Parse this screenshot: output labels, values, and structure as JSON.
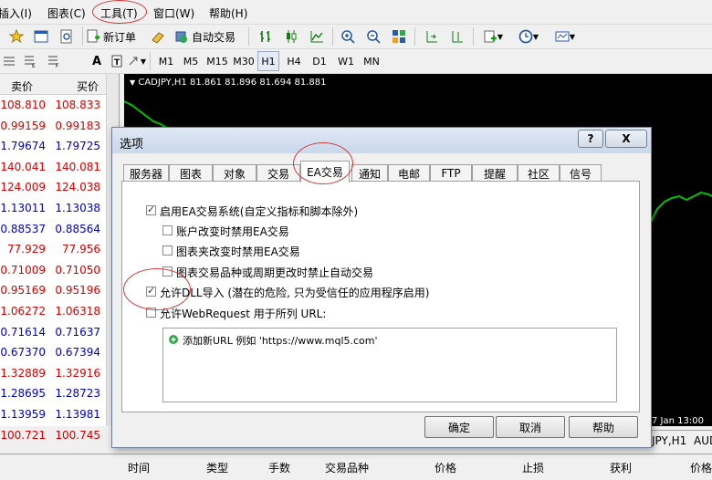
{
  "menu": {
    "items": [
      "插入(I)",
      "图表(C)",
      "工具(T)",
      "窗口(W)",
      "帮助(H)"
    ]
  },
  "toolbar1": {
    "new_order": "新订单",
    "auto_trading": "自动交易"
  },
  "toolbar2": {
    "timeframes": [
      "M1",
      "M5",
      "M15",
      "M30",
      "H1",
      "H4",
      "D1",
      "W1",
      "MN"
    ]
  },
  "market_watch": {
    "col_bid": "卖价",
    "col_ask": "买价",
    "rows": [
      {
        "bid": "108.810",
        "ask": "108.833",
        "color": "red"
      },
      {
        "bid": "0.99159",
        "ask": "0.99183",
        "color": "red"
      },
      {
        "bid": "1.79674",
        "ask": "1.79725",
        "color": "blue"
      },
      {
        "bid": "140.041",
        "ask": "140.081",
        "color": "red"
      },
      {
        "bid": "124.009",
        "ask": "124.038",
        "color": "red"
      },
      {
        "bid": "1.13011",
        "ask": "1.13038",
        "color": "blue"
      },
      {
        "bid": "0.88537",
        "ask": "0.88564",
        "color": "blue"
      },
      {
        "bid": "77.929",
        "ask": "77.956",
        "color": "red"
      },
      {
        "bid": "0.71009",
        "ask": "0.71050",
        "color": "red"
      },
      {
        "bid": "0.95169",
        "ask": "0.95196",
        "color": "red"
      },
      {
        "bid": "1.06272",
        "ask": "1.06318",
        "color": "red"
      },
      {
        "bid": "0.71614",
        "ask": "0.71637",
        "color": "blue"
      },
      {
        "bid": "0.67370",
        "ask": "0.67394",
        "color": "blue"
      },
      {
        "bid": "1.32889",
        "ask": "1.32916",
        "color": "red"
      },
      {
        "bid": "1.28695",
        "ask": "1.28723",
        "color": "blue"
      },
      {
        "bid": "1.13959",
        "ask": "1.13981",
        "color": "blue"
      },
      {
        "bid": "100.721",
        "ask": "100.745",
        "color": "red"
      }
    ]
  },
  "chart": {
    "header": "CADJPY,H1  81.861 81.896 81.694 81.881",
    "date_label": "7 Jan 13:00",
    "tab_partial": "JPY,H1",
    "tab_partial2": "AUD"
  },
  "terminal": {
    "columns": [
      "时间",
      "类型",
      "手数",
      "交易品种",
      "价格",
      "止损",
      "获利",
      "价格"
    ]
  },
  "dialog": {
    "title": "选项",
    "help_btn": "?",
    "close_btn": "X",
    "tabs": [
      "服务器",
      "图表",
      "对象",
      "交易",
      "EA交易",
      "通知",
      "电邮",
      "FTP",
      "提醒",
      "社区",
      "信号"
    ],
    "active_tab": "EA交易",
    "options": [
      {
        "label": "启用EA交易系统(自定义指标和脚本除外)",
        "checked": true
      },
      {
        "label": "账户改变时禁用EA交易",
        "checked": false
      },
      {
        "label": "图表夹改变时禁用EA交易",
        "checked": false
      },
      {
        "label": "图表交易品种或周期更改时禁止自动交易",
        "checked": false
      },
      {
        "label": "允许DLL导入 (潜在的危险, 只为受信任的应用程序启用)",
        "checked": true
      },
      {
        "label": "允许WebRequest 用于所列 URL:",
        "checked": false
      }
    ],
    "add_url": "添加新URL 例如 'https://www.mql5.com'",
    "ok": "确定",
    "cancel": "取消",
    "help": "帮助"
  },
  "colors": {
    "red_quote": "#d40000",
    "blue_quote": "#0000c8",
    "chart_bg": "#000000",
    "chart_line": "#00c000",
    "highlight_circle": "#d23a3a"
  }
}
